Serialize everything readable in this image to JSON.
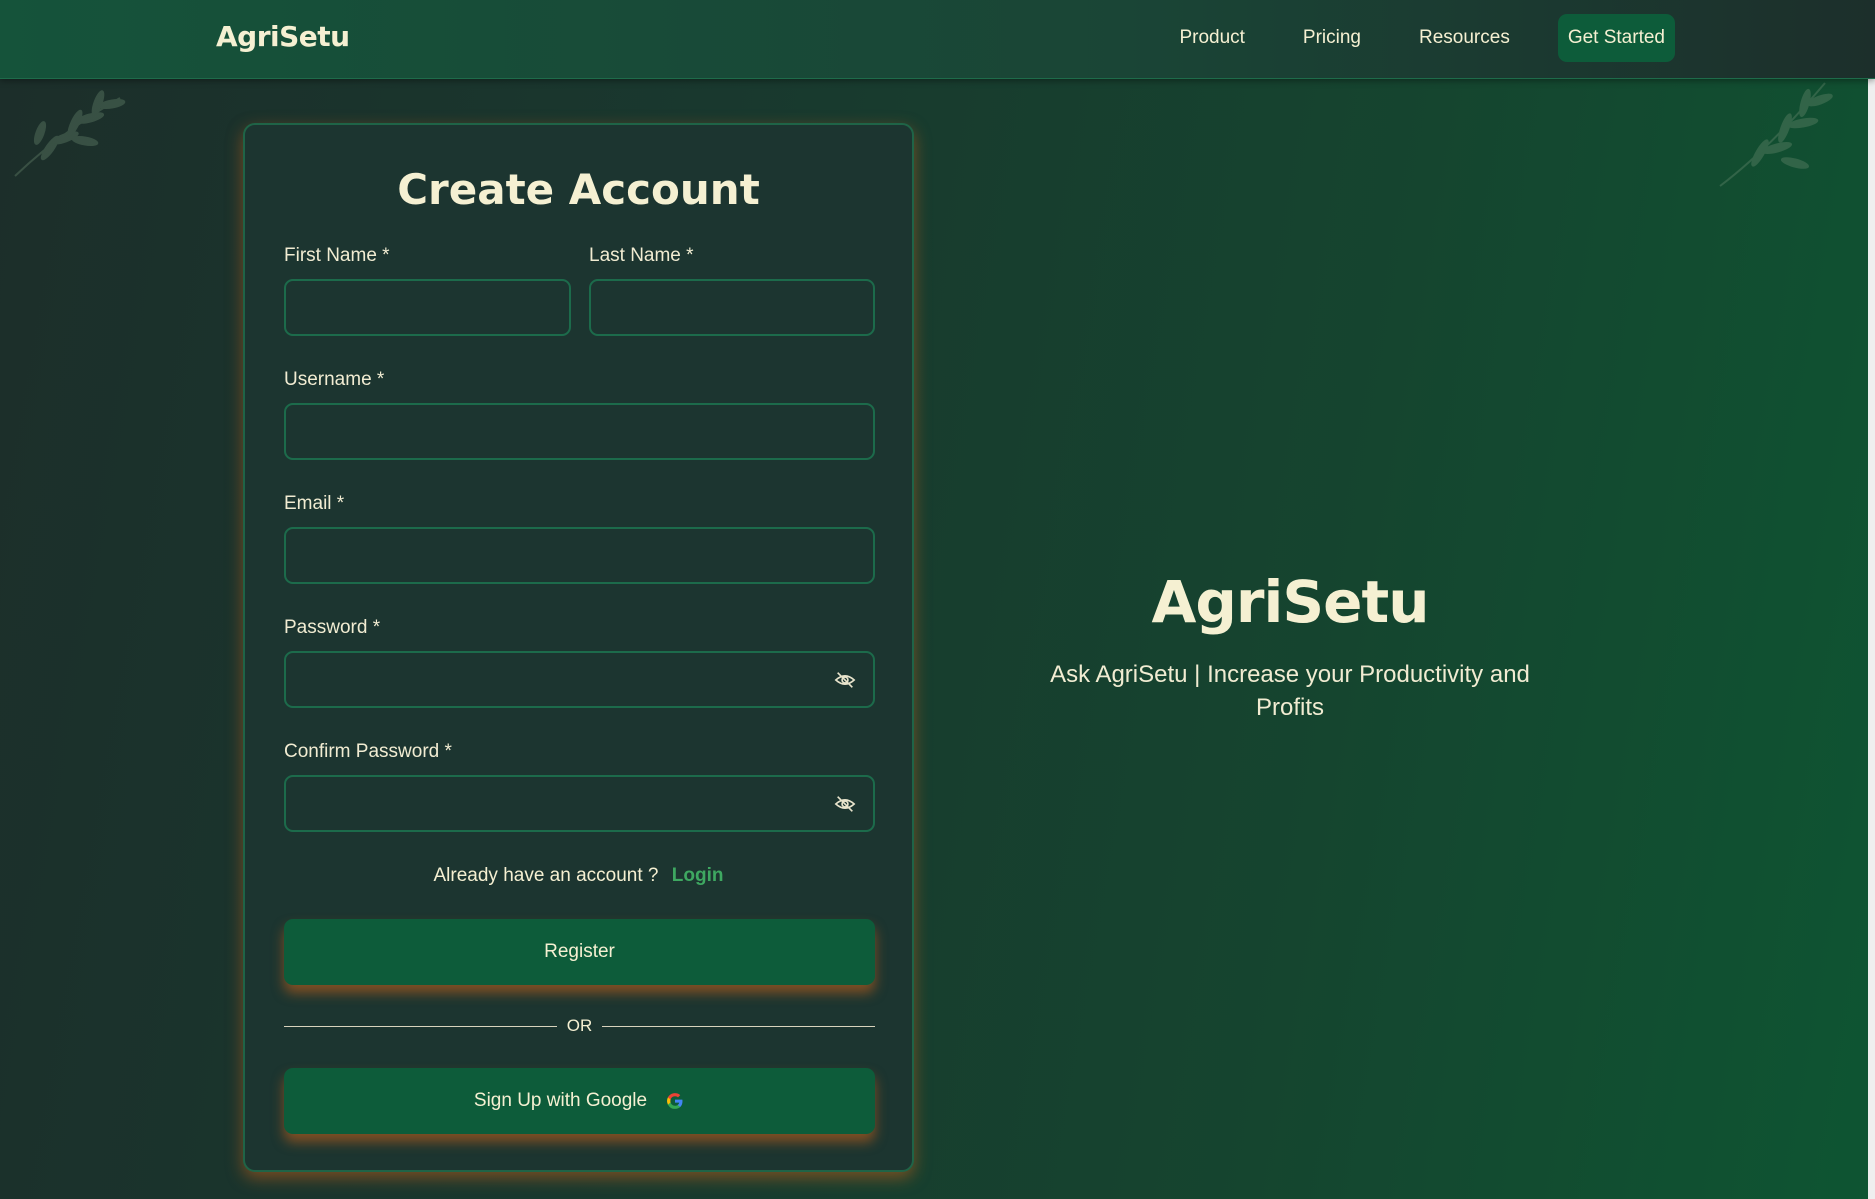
{
  "navbar": {
    "brand": "AgriSetu",
    "links": [
      {
        "label": "Product"
      },
      {
        "label": "Pricing"
      },
      {
        "label": "Resources"
      }
    ],
    "cta_label": "Get Started"
  },
  "form": {
    "title": "Create Account",
    "fields": {
      "first_name": {
        "label": "First Name *",
        "value": "",
        "placeholder": ""
      },
      "last_name": {
        "label": "Last Name *",
        "value": "",
        "placeholder": ""
      },
      "username": {
        "label": "Username *",
        "value": "",
        "placeholder": ""
      },
      "email": {
        "label": "Email *",
        "value": "",
        "placeholder": ""
      },
      "password": {
        "label": "Password *",
        "value": "",
        "placeholder": ""
      },
      "confirm_password": {
        "label": "Confirm Password *",
        "value": "",
        "placeholder": ""
      }
    },
    "login_prompt": "Already have an account ?",
    "login_link": "Login",
    "register_label": "Register",
    "divider_label": "OR",
    "google_label": "Sign Up with Google"
  },
  "hero": {
    "title": "AgriSetu",
    "subtitle": "Ask AgriSetu | Increase your Productivity and Profits"
  },
  "colors": {
    "accent_green": "#0d5c3a",
    "link_green": "#3ea861",
    "text_cream": "#f5f0d2",
    "glow_orange": "#c4601a"
  },
  "icons": {
    "password_toggle": "eye-slash-icon",
    "google": "google-icon",
    "decor": "leaf-branch-icon"
  }
}
